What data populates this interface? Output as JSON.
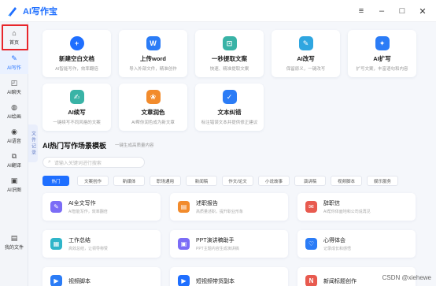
{
  "app": {
    "title": "AI写作宝",
    "brand_color": "#1f6fff"
  },
  "window_controls": {
    "menu": "≡",
    "minimize": "–",
    "maximize": "□",
    "close": "✕"
  },
  "sidebar": {
    "items": [
      {
        "label": "首页",
        "icon": "home-icon"
      },
      {
        "label": "AI写作",
        "icon": "edit-icon"
      },
      {
        "label": "AI聊天",
        "icon": "chat-icon"
      },
      {
        "label": "AI绘画",
        "icon": "paint-icon"
      },
      {
        "label": "AI语音",
        "icon": "voice-icon"
      },
      {
        "label": "AI翻译",
        "icon": "translate-icon"
      },
      {
        "label": "AI识图",
        "icon": "image-icon"
      }
    ],
    "bottom": {
      "label": "我的文件",
      "icon": "file-icon"
    }
  },
  "tools": [
    {
      "title": "新建空白文档",
      "sub": "AI智能写作，效率翻倍",
      "icon": "plus-icon",
      "glyph": "+",
      "color": "#1f6fff"
    },
    {
      "title": "上传word",
      "sub": "导入外部文件，精准创作",
      "icon": "word-icon",
      "glyph": "W",
      "color": "#2b7cf6"
    },
    {
      "title": "一秒提取文案",
      "sub": "快速、精准提取文案",
      "icon": "scan-icon",
      "glyph": "⊡",
      "color": "#39b3a6"
    },
    {
      "title": "AI改写",
      "sub": "保留原义，一键改写",
      "icon": "rewrite-icon",
      "glyph": "✎",
      "color": "#2fa6e0"
    },
    {
      "title": "AI扩写",
      "sub": "扩写文案，丰富语句和内容",
      "icon": "expand-icon",
      "glyph": "✦",
      "color": "#2b7cf6"
    },
    {
      "title": "AI续写",
      "sub": "一键续写不同风格的文案",
      "icon": "continue-icon",
      "glyph": "✍",
      "color": "#39b3a6"
    },
    {
      "title": "文章润色",
      "sub": "AI帮你润色成为新文章",
      "icon": "polish-icon",
      "glyph": "❀",
      "color": "#f28b2c"
    },
    {
      "title": "文本纠错",
      "sub": "标注错误文本并提供修正建议",
      "icon": "check-icon",
      "glyph": "✓",
      "color": "#2b7cf6"
    }
  ],
  "side_tab": "文件记录",
  "templates": {
    "title": "AI热门写作场景模板",
    "subtitle": "一键生成高质量内容",
    "search_placeholder": "请输入关键词进行搜索",
    "tabs": [
      "热门",
      "文案创作",
      "新媒体",
      "职场通用",
      "新闻稿",
      "作文/论文",
      "小说故事",
      "演讲稿",
      "视频脚本",
      "娱乐服务"
    ],
    "active_tab": 0,
    "cards": [
      {
        "title": "AI全文写作",
        "sub": "AI智能写作，效率翻倍",
        "icon": "ai-write-icon",
        "glyph": "✎",
        "color": "#7b6cf6"
      },
      {
        "title": "述职报告",
        "sub": "高质量述职，提升职业形象",
        "icon": "report-icon",
        "glyph": "▤",
        "color": "#f28b2c"
      },
      {
        "title": "辞职信",
        "sub": "AI帮你体面地和公司说再见",
        "icon": "resign-icon",
        "glyph": "✉",
        "color": "#e85a4f"
      },
      {
        "title": "工作总结",
        "sub": "高效总结，让领导称赞",
        "icon": "summary-icon",
        "glyph": "▦",
        "color": "#2fb5c9"
      },
      {
        "title": "PPT演讲稿助手",
        "sub": "PPT主题内容生成演讲稿",
        "icon": "ppt-icon",
        "glyph": "▣",
        "color": "#7b6cf6"
      },
      {
        "title": "心得体会",
        "sub": "记录成长和感悟",
        "icon": "heart-icon",
        "glyph": "♡",
        "color": "#2b7cf6"
      },
      {
        "title": "视频脚本",
        "sub": "",
        "icon": "video-icon",
        "glyph": "▶",
        "color": "#2b7cf6"
      },
      {
        "title": "短视频带货副本",
        "sub": "",
        "icon": "short-video-icon",
        "glyph": "▶",
        "color": "#1f6fff"
      },
      {
        "title": "新闻标题创作",
        "sub": "",
        "icon": "news-icon",
        "glyph": "N",
        "color": "#e85a4f"
      }
    ]
  },
  "watermark": "CSDN @xiehewe"
}
